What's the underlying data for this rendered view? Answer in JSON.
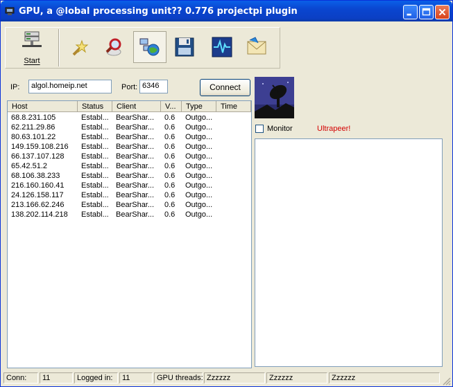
{
  "window": {
    "title": "GPU, a @lobal processing unit?? 0.776 projectpi plugin"
  },
  "toolbar": {
    "start_label": "Start",
    "tools": [
      {
        "name": "start-server-icon"
      },
      {
        "name": "wizard-icon"
      },
      {
        "name": "search-magnifier-icon"
      },
      {
        "name": "network-globe-icon"
      },
      {
        "name": "save-floppy-icon"
      },
      {
        "name": "monitor-waveform-icon"
      },
      {
        "name": "mail-envelope-icon"
      }
    ]
  },
  "connection": {
    "ip_label": "IP:",
    "ip_value": "algol.homeip.net",
    "port_label": "Port:",
    "port_value": "6346",
    "connect_label": "Connect"
  },
  "hosts_table": {
    "columns": [
      "Host",
      "Status",
      "Client",
      "V...",
      "Type",
      "Time"
    ],
    "rows": [
      [
        "68.8.231.105",
        "Establ...",
        "BearShar...",
        "0.6",
        "Outgo...",
        ""
      ],
      [
        "62.211.29.86",
        "Establ...",
        "BearShar...",
        "0.6",
        "Outgo...",
        ""
      ],
      [
        "80.63.101.22",
        "Establ...",
        "BearShar...",
        "0.6",
        "Outgo...",
        ""
      ],
      [
        "149.159.108.216",
        "Establ...",
        "BearShar...",
        "0.6",
        "Outgo...",
        ""
      ],
      [
        "66.137.107.128",
        "Establ...",
        "BearShar...",
        "0.6",
        "Outgo...",
        ""
      ],
      [
        "65.42.51.2",
        "Establ...",
        "BearShar...",
        "0.6",
        "Outgo...",
        ""
      ],
      [
        "68.106.38.233",
        "Establ...",
        "BearShar...",
        "0.6",
        "Outgo...",
        ""
      ],
      [
        "216.160.160.41",
        "Establ...",
        "BearShar...",
        "0.6",
        "Outgo...",
        ""
      ],
      [
        "24.126.158.117",
        "Establ...",
        "BearShar...",
        "0.6",
        "Outgo...",
        ""
      ],
      [
        "213.166.62.246",
        "Establ...",
        "BearShar...",
        "0.6",
        "Outgo...",
        ""
      ],
      [
        "138.202.114.218",
        "Establ...",
        "BearShar...",
        "0.6",
        "Outgo...",
        ""
      ]
    ]
  },
  "monitor": {
    "label": "Monitor",
    "checked": false,
    "ultrapeer_label": "Ultrapeer!",
    "ultrapeer_color": "#d40000"
  },
  "statusbar": {
    "conn_label": "Conn:",
    "conn_value": "11",
    "logged_label": "Logged in:",
    "logged_value": "11",
    "threads_label": "GPU threads:",
    "thread1": "Zzzzzz",
    "thread2": "Zzzzzz",
    "thread3": "Zzzzzz"
  },
  "colors": {
    "titlebar": "#0a46d0",
    "window_bg": "#ece9d8"
  }
}
